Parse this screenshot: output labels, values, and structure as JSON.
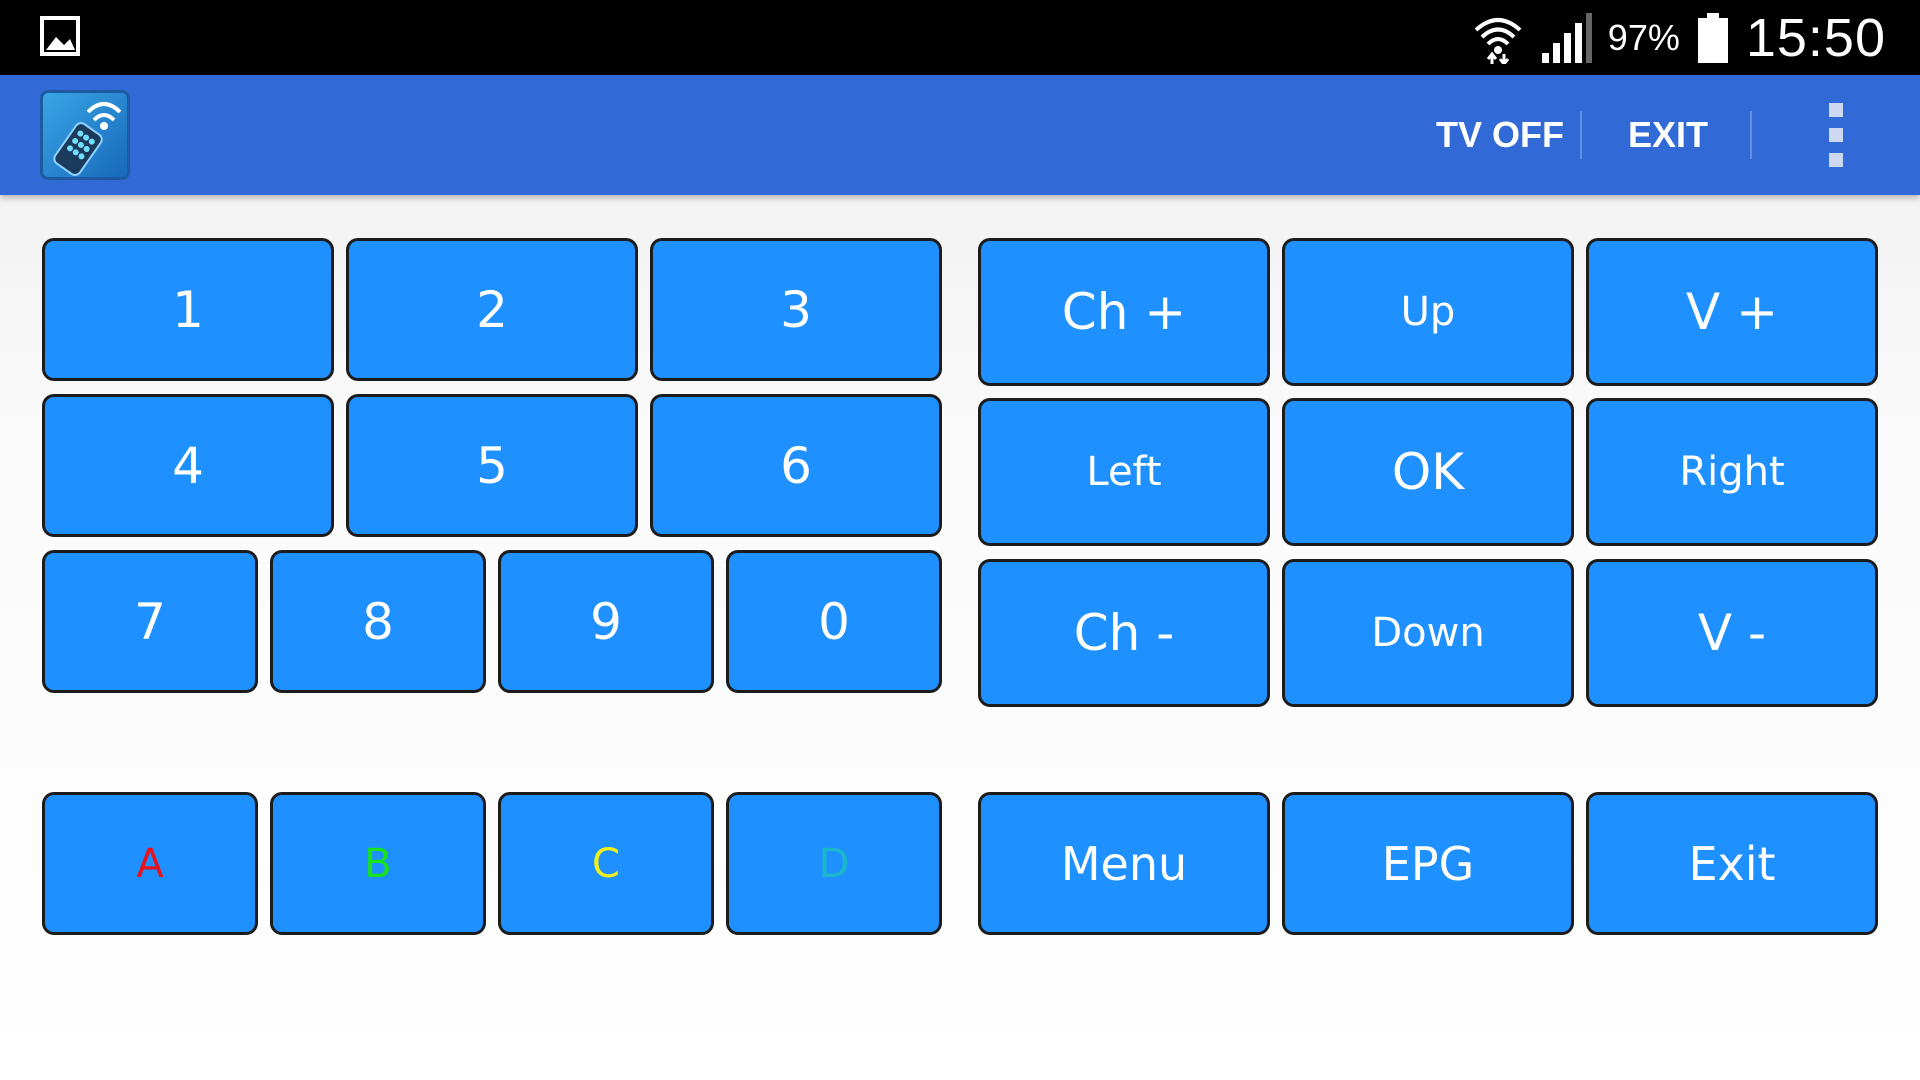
{
  "status_bar": {
    "battery_percent": "97%",
    "time": "15:50",
    "icons": [
      "image-notification-icon",
      "wifi-icon",
      "signal-icon",
      "battery-icon"
    ]
  },
  "app_bar": {
    "logo_icon": "remote-control-wifi-icon",
    "actions": {
      "tv_off": "TV OFF",
      "exit": "EXIT"
    },
    "overflow_icon": "more-vert-icon"
  },
  "number_pad": {
    "row1": [
      "1",
      "2",
      "3"
    ],
    "row2": [
      "4",
      "5",
      "6"
    ],
    "row3": [
      "7",
      "8",
      "9",
      "0"
    ]
  },
  "nav_pad": {
    "row1": [
      "Ch +",
      "Up",
      "V +"
    ],
    "row2": [
      "Left",
      "OK",
      "Right"
    ],
    "row3": [
      "Ch -",
      "Down",
      "V -"
    ]
  },
  "color_buttons": [
    {
      "label": "A",
      "color": "#e8121a"
    },
    {
      "label": "B",
      "color": "#19e21c"
    },
    {
      "label": "C",
      "color": "#f0f01a"
    },
    {
      "label": "D",
      "color": "#1ab8c8"
    }
  ],
  "function_buttons": [
    "Menu",
    "EPG",
    "Exit"
  ],
  "colors": {
    "button_bg": "#1e90ff",
    "app_bar": "#3169d6",
    "status_bar": "#000000"
  }
}
